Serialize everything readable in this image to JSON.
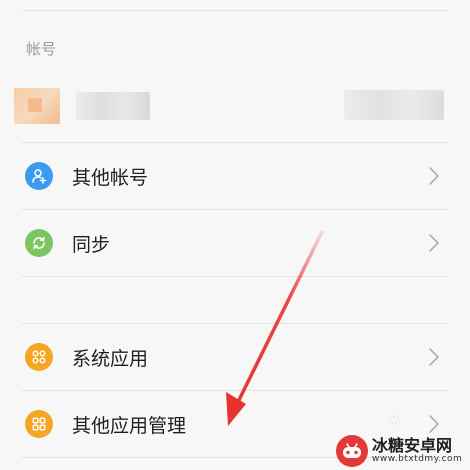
{
  "section_account": {
    "header": "帐号"
  },
  "account": {
    "avatar_icon": "blurred-avatar",
    "name_redacted": true
  },
  "rows": [
    {
      "label": "其他帐号",
      "icon": "add-user-icon",
      "icon_color": "#3b9bf0"
    },
    {
      "label": "同步",
      "icon": "sync-icon",
      "icon_color": "#7cc661"
    },
    {
      "label": "系统应用",
      "icon": "apps-grid-icon",
      "icon_color": "#f5a623"
    },
    {
      "label": "其他应用管理",
      "icon": "apps-grid-icon",
      "icon_color": "#f5a623"
    }
  ],
  "annotation": {
    "arrow_color": "#e8322e"
  },
  "watermark": {
    "name": "冰糖安卓网",
    "url": "www.btxtdmy.com",
    "logo_color": "#e23a3a"
  },
  "colors": {
    "background": "#f7f7f7",
    "divider": "#e3e3e3",
    "chevron": "#b0b0b0"
  }
}
